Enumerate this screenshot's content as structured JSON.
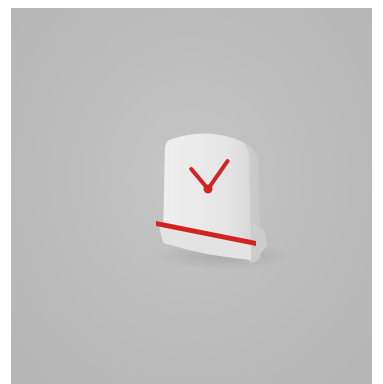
{
  "scene": {
    "subject": "desk-clock-render",
    "colors": {
      "background": "#bdbdbd",
      "clock_body": "#e9e9e9",
      "clock_shade": "#cfcfcf",
      "accent_red": "#d32222"
    },
    "clock": {
      "hour_hand_angle_deg": -40,
      "minute_hand_angle_deg": 35
    }
  }
}
